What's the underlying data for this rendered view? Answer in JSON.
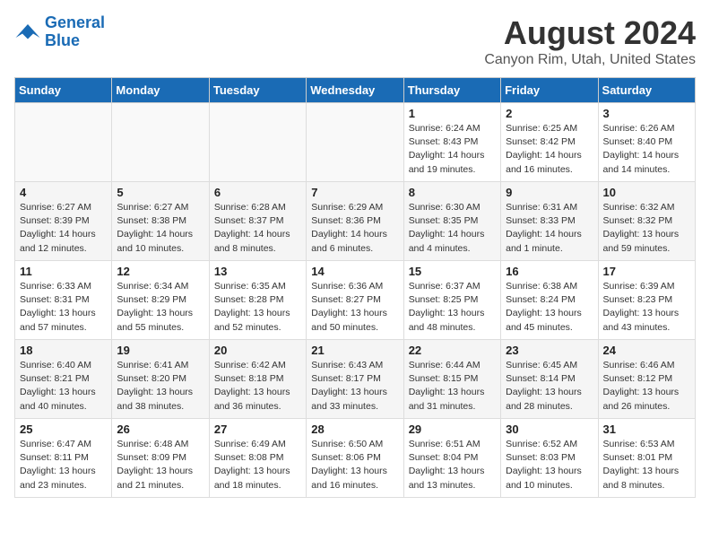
{
  "header": {
    "logo_general": "General",
    "logo_blue": "Blue",
    "title": "August 2024",
    "subtitle": "Canyon Rim, Utah, United States"
  },
  "days_of_week": [
    "Sunday",
    "Monday",
    "Tuesday",
    "Wednesday",
    "Thursday",
    "Friday",
    "Saturday"
  ],
  "weeks": [
    [
      {
        "day": "",
        "info": ""
      },
      {
        "day": "",
        "info": ""
      },
      {
        "day": "",
        "info": ""
      },
      {
        "day": "",
        "info": ""
      },
      {
        "day": "1",
        "info": "Sunrise: 6:24 AM\nSunset: 8:43 PM\nDaylight: 14 hours\nand 19 minutes."
      },
      {
        "day": "2",
        "info": "Sunrise: 6:25 AM\nSunset: 8:42 PM\nDaylight: 14 hours\nand 16 minutes."
      },
      {
        "day": "3",
        "info": "Sunrise: 6:26 AM\nSunset: 8:40 PM\nDaylight: 14 hours\nand 14 minutes."
      }
    ],
    [
      {
        "day": "4",
        "info": "Sunrise: 6:27 AM\nSunset: 8:39 PM\nDaylight: 14 hours\nand 12 minutes."
      },
      {
        "day": "5",
        "info": "Sunrise: 6:27 AM\nSunset: 8:38 PM\nDaylight: 14 hours\nand 10 minutes."
      },
      {
        "day": "6",
        "info": "Sunrise: 6:28 AM\nSunset: 8:37 PM\nDaylight: 14 hours\nand 8 minutes."
      },
      {
        "day": "7",
        "info": "Sunrise: 6:29 AM\nSunset: 8:36 PM\nDaylight: 14 hours\nand 6 minutes."
      },
      {
        "day": "8",
        "info": "Sunrise: 6:30 AM\nSunset: 8:35 PM\nDaylight: 14 hours\nand 4 minutes."
      },
      {
        "day": "9",
        "info": "Sunrise: 6:31 AM\nSunset: 8:33 PM\nDaylight: 14 hours\nand 1 minute."
      },
      {
        "day": "10",
        "info": "Sunrise: 6:32 AM\nSunset: 8:32 PM\nDaylight: 13 hours\nand 59 minutes."
      }
    ],
    [
      {
        "day": "11",
        "info": "Sunrise: 6:33 AM\nSunset: 8:31 PM\nDaylight: 13 hours\nand 57 minutes."
      },
      {
        "day": "12",
        "info": "Sunrise: 6:34 AM\nSunset: 8:29 PM\nDaylight: 13 hours\nand 55 minutes."
      },
      {
        "day": "13",
        "info": "Sunrise: 6:35 AM\nSunset: 8:28 PM\nDaylight: 13 hours\nand 52 minutes."
      },
      {
        "day": "14",
        "info": "Sunrise: 6:36 AM\nSunset: 8:27 PM\nDaylight: 13 hours\nand 50 minutes."
      },
      {
        "day": "15",
        "info": "Sunrise: 6:37 AM\nSunset: 8:25 PM\nDaylight: 13 hours\nand 48 minutes."
      },
      {
        "day": "16",
        "info": "Sunrise: 6:38 AM\nSunset: 8:24 PM\nDaylight: 13 hours\nand 45 minutes."
      },
      {
        "day": "17",
        "info": "Sunrise: 6:39 AM\nSunset: 8:23 PM\nDaylight: 13 hours\nand 43 minutes."
      }
    ],
    [
      {
        "day": "18",
        "info": "Sunrise: 6:40 AM\nSunset: 8:21 PM\nDaylight: 13 hours\nand 40 minutes."
      },
      {
        "day": "19",
        "info": "Sunrise: 6:41 AM\nSunset: 8:20 PM\nDaylight: 13 hours\nand 38 minutes."
      },
      {
        "day": "20",
        "info": "Sunrise: 6:42 AM\nSunset: 8:18 PM\nDaylight: 13 hours\nand 36 minutes."
      },
      {
        "day": "21",
        "info": "Sunrise: 6:43 AM\nSunset: 8:17 PM\nDaylight: 13 hours\nand 33 minutes."
      },
      {
        "day": "22",
        "info": "Sunrise: 6:44 AM\nSunset: 8:15 PM\nDaylight: 13 hours\nand 31 minutes."
      },
      {
        "day": "23",
        "info": "Sunrise: 6:45 AM\nSunset: 8:14 PM\nDaylight: 13 hours\nand 28 minutes."
      },
      {
        "day": "24",
        "info": "Sunrise: 6:46 AM\nSunset: 8:12 PM\nDaylight: 13 hours\nand 26 minutes."
      }
    ],
    [
      {
        "day": "25",
        "info": "Sunrise: 6:47 AM\nSunset: 8:11 PM\nDaylight: 13 hours\nand 23 minutes."
      },
      {
        "day": "26",
        "info": "Sunrise: 6:48 AM\nSunset: 8:09 PM\nDaylight: 13 hours\nand 21 minutes."
      },
      {
        "day": "27",
        "info": "Sunrise: 6:49 AM\nSunset: 8:08 PM\nDaylight: 13 hours\nand 18 minutes."
      },
      {
        "day": "28",
        "info": "Sunrise: 6:50 AM\nSunset: 8:06 PM\nDaylight: 13 hours\nand 16 minutes."
      },
      {
        "day": "29",
        "info": "Sunrise: 6:51 AM\nSunset: 8:04 PM\nDaylight: 13 hours\nand 13 minutes."
      },
      {
        "day": "30",
        "info": "Sunrise: 6:52 AM\nSunset: 8:03 PM\nDaylight: 13 hours\nand 10 minutes."
      },
      {
        "day": "31",
        "info": "Sunrise: 6:53 AM\nSunset: 8:01 PM\nDaylight: 13 hours\nand 8 minutes."
      }
    ]
  ]
}
